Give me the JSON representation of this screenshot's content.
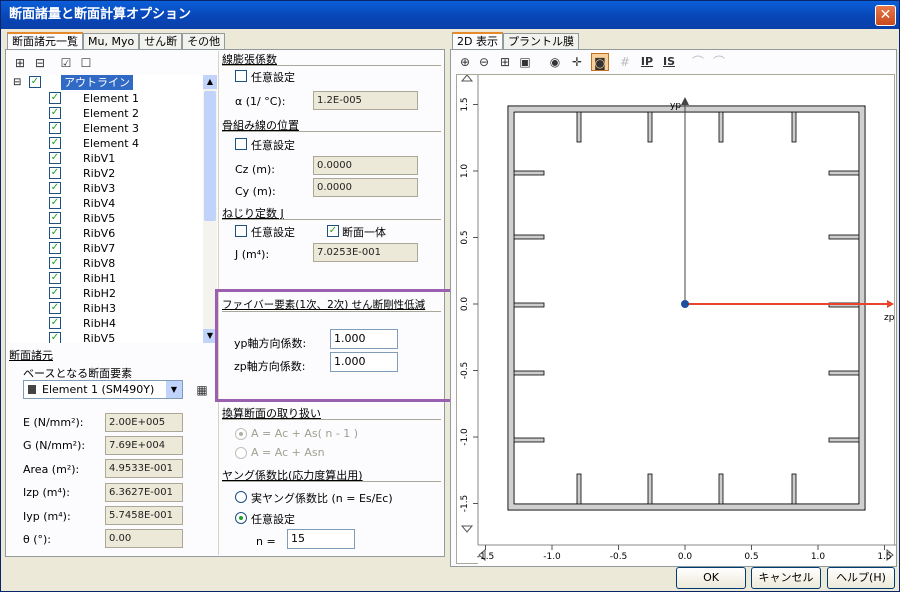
{
  "window": {
    "title": "断面諸量と断面計算オプション",
    "close_glyph": "✕"
  },
  "left_tabs": [
    "断面諸元一覧",
    "Mu, Myo",
    "せん断",
    "その他"
  ],
  "tree": {
    "toolbar_icons": [
      "expand-all-icon",
      "collapse-all-icon",
      "check-all-icon",
      "uncheck-all-icon"
    ],
    "root_label": "アウトライン",
    "items": [
      "Element 1",
      "Element 2",
      "Element 3",
      "Element 4",
      "RibV1",
      "RibV2",
      "RibV3",
      "RibV4",
      "RibV5",
      "RibV6",
      "RibV7",
      "RibV8",
      "RibH1",
      "RibH2",
      "RibH3",
      "RibH4",
      "RibV5"
    ]
  },
  "props": {
    "header": "断面諸元",
    "base_label": "ベースとなる断面要素",
    "base_value": "Element 1 (SM490Y)",
    "rows": [
      {
        "label": "E (N/mm²):",
        "value": "2.00E+005"
      },
      {
        "label": "G (N/mm²):",
        "value": "7.69E+004"
      },
      {
        "label": "Area (m²):",
        "value": "4.9533E-001"
      },
      {
        "label": "Izp (m⁴):",
        "value": "6.3627E-001"
      },
      {
        "label": "Iyp (m⁴):",
        "value": "5.7458E-001"
      },
      {
        "label": "θ (°):",
        "value": "0.00"
      }
    ]
  },
  "thermal": {
    "header": "線膨張係数",
    "arbitrary": "任意設定",
    "alpha_label": "α (1/ °C):",
    "alpha_value": "1.2E-005"
  },
  "skeleton": {
    "header": "骨組み線の位置",
    "arbitrary": "任意設定",
    "cz_label": "Cz (m):",
    "cz_value": "0.0000",
    "cy_label": "Cy (m):",
    "cy_value": "0.0000"
  },
  "torsion": {
    "header": "ねじり定数 J",
    "arbitrary": "任意設定",
    "integral": "断面一体",
    "j_label": "J (m⁴):",
    "j_value": "7.0253E-001"
  },
  "fiber": {
    "header": "ファイバー要素(1次、2次) せん断剛性低減",
    "yp_label": "yp軸方向係数:",
    "yp_value": "1.000",
    "zp_label": "zp軸方向係数:",
    "zp_value": "1.000",
    "highlight_color": "#9b5fb0"
  },
  "converted": {
    "header": "換算断面の取り扱い",
    "opt1": "A = Ac + As( n - 1 )",
    "opt2": "A = Ac + Asn"
  },
  "young": {
    "header": "ヤング係数比(応力度算出用)",
    "opt1": "実ヤング係数比 (n = Es/Ec)",
    "opt2": "任意設定",
    "n_label": "n =",
    "n_value": "15"
  },
  "right_tabs": [
    "2D 表示",
    "プラントル膜"
  ],
  "plot": {
    "x_ticks": [
      "-1.5",
      "-1.0",
      "-0.5",
      "0.0",
      "0.5",
      "1.0",
      "1.5"
    ],
    "y_ticks": [
      "-1.5",
      "-1.0",
      "-0.5",
      "0.0",
      "0.5",
      "1.0",
      "1.5"
    ],
    "yp_label": "yp",
    "zp_label": "zp",
    "axis_color": "#e8452c",
    "origin_color": "#1f4fa0"
  },
  "buttons": {
    "ok": "OK",
    "cancel": "キャンセル",
    "help": "ヘルプ(H)"
  }
}
